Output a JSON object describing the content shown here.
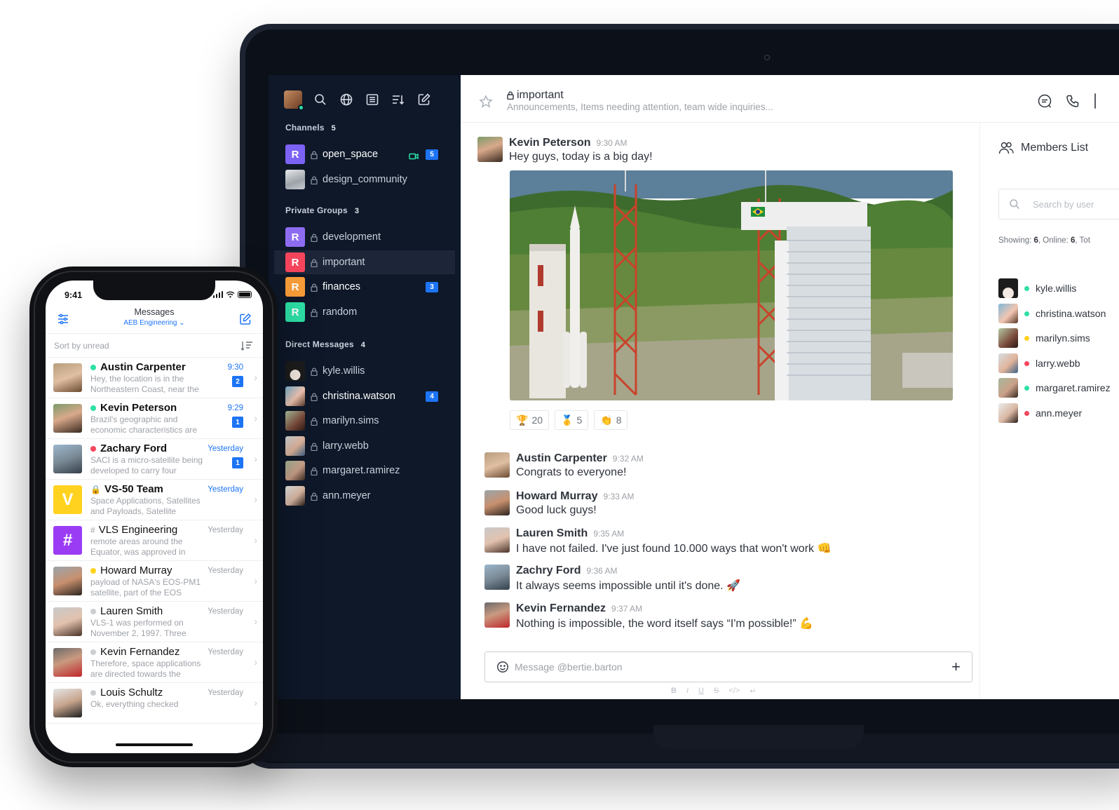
{
  "laptop": {
    "sidebar": {
      "sections": {
        "channels": {
          "label": "Channels",
          "count": "5"
        },
        "private_groups": {
          "label": "Private Groups",
          "count": "3"
        },
        "direct_messages": {
          "label": "Direct Messages",
          "count": "4"
        }
      },
      "channels": [
        {
          "name": "open_space",
          "avatar": "R",
          "color": "#7c62f5",
          "badge": "5",
          "icon": "video-icon"
        },
        {
          "name": "design_community",
          "avatar": "",
          "color": "#9aa0a8"
        }
      ],
      "groups": [
        {
          "name": "development",
          "avatar": "R",
          "color": "#8e6cf2"
        },
        {
          "name": "important",
          "avatar": "R",
          "color": "#f5455c"
        },
        {
          "name": "finances",
          "avatar": "R",
          "color": "#f79c39"
        },
        {
          "name": "random",
          "avatar": "R",
          "color": "#2de0a5"
        }
      ],
      "dms": [
        {
          "name": "kyle.willis"
        },
        {
          "name": "christina.watson",
          "badge": "4"
        },
        {
          "name": "marilyn.sims"
        },
        {
          "name": "larry.webb"
        },
        {
          "name": "margaret.ramirez"
        },
        {
          "name": "ann.meyer"
        }
      ]
    },
    "header": {
      "room": "important",
      "topic": "Announcements, Items needing attention, team wide inquiries..."
    },
    "messages": [
      {
        "author": "Kevin Peterson",
        "time": "9:30 AM",
        "text": "Hey guys, today is a big day!"
      },
      {
        "author": "Austin Carpenter",
        "time": "9:32 AM",
        "text": "Congrats to everyone!"
      },
      {
        "author": "Howard Murray",
        "time": "9:33 AM",
        "text": "Good luck guys!"
      },
      {
        "author": "Lauren Smith",
        "time": "9:35 AM",
        "text": "I have not failed. I've just found 10.000 ways that won't work 👊"
      },
      {
        "author": "Zachry Ford",
        "time": "9:36 AM",
        "text": "It always seems impossible until it's done. 🚀"
      },
      {
        "author": "Kevin Fernandez",
        "time": "9:37 AM",
        "text": "Nothing is impossible, the word itself says “I'm possible!” 💪"
      }
    ],
    "reactions": [
      {
        "emoji": "🏆",
        "count": "20"
      },
      {
        "emoji": "🥇",
        "count": "5"
      },
      {
        "emoji": "👏",
        "count": "8"
      }
    ],
    "composer": {
      "placeholder": "Message @bertie.barton",
      "format": [
        "B",
        "I",
        "U",
        "S",
        "</>",
        "↵"
      ]
    },
    "members": {
      "title": "Members List",
      "search_placeholder": "Search by user",
      "stat_showing_label": "Showing: ",
      "stat_showing": "6",
      "stat_online_label": ", Online: ",
      "stat_online": "6",
      "stat_total_label": ", Tot",
      "list": [
        {
          "name": "kyle.willis",
          "status": "#2de0a5"
        },
        {
          "name": "christina.watson",
          "status": "#2de0a5"
        },
        {
          "name": "marilyn.sims",
          "status": "#ffd21f"
        },
        {
          "name": "larry.webb",
          "status": "#f5455c"
        },
        {
          "name": "margaret.ramirez",
          "status": "#2de0a5"
        },
        {
          "name": "ann.meyer",
          "status": "#f5455c"
        }
      ]
    }
  },
  "phone": {
    "time": "9:41",
    "title": "Messages",
    "workspace": "AEB Engineering",
    "sort_label": "Sort by unread",
    "rows": [
      {
        "name": "Austin Carpenter",
        "status": "#2de0a5",
        "bold": true,
        "text": "Hey, the location is in the Northeastern Coast, near the",
        "time": "9:30",
        "unread": "2"
      },
      {
        "name": "Kevin Peterson",
        "status": "#2de0a5",
        "bold": true,
        "text": "Brazil's geographic and economic characteristics are",
        "time": "9:29",
        "unread": "1"
      },
      {
        "name": "Zachary Ford",
        "status": "#f5455c",
        "bold": true,
        "text": "SACI is a micro-satellite being developed to carry four",
        "time": "Yesterday",
        "unread": "1"
      },
      {
        "name": "VS-50 Team",
        "prefix": "🔒",
        "bold": true,
        "text": "Space Applications, Satellites and Payloads, Satellite",
        "time": "Yesterday",
        "avatar": "V"
      },
      {
        "name": "VLS Engineering",
        "prefix": "#",
        "bold": false,
        "text": "remote areas around the Equator, was approved in",
        "time": "Yesterday",
        "avatar": "#"
      },
      {
        "name": "Howard Murray",
        "status": "#ffd21f",
        "bold": false,
        "text": "payload of NASA's EOS-PM1 satellite, part of the EOS",
        "time": "Yesterday"
      },
      {
        "name": "Lauren Smith",
        "status": "#cbced1",
        "bold": false,
        "text": "VLS-1 was performed on November 2, 1997. Three",
        "time": "Yesterday"
      },
      {
        "name": "Kevin Fernandez",
        "status": "#cbced1",
        "bold": false,
        "text": "Therefore, space applications are directed towards the",
        "time": "Yesterday"
      },
      {
        "name": "Louis Schultz",
        "status": "#cbced1",
        "bold": false,
        "text": "Ok, everything checked",
        "time": "Yesterday"
      }
    ]
  }
}
